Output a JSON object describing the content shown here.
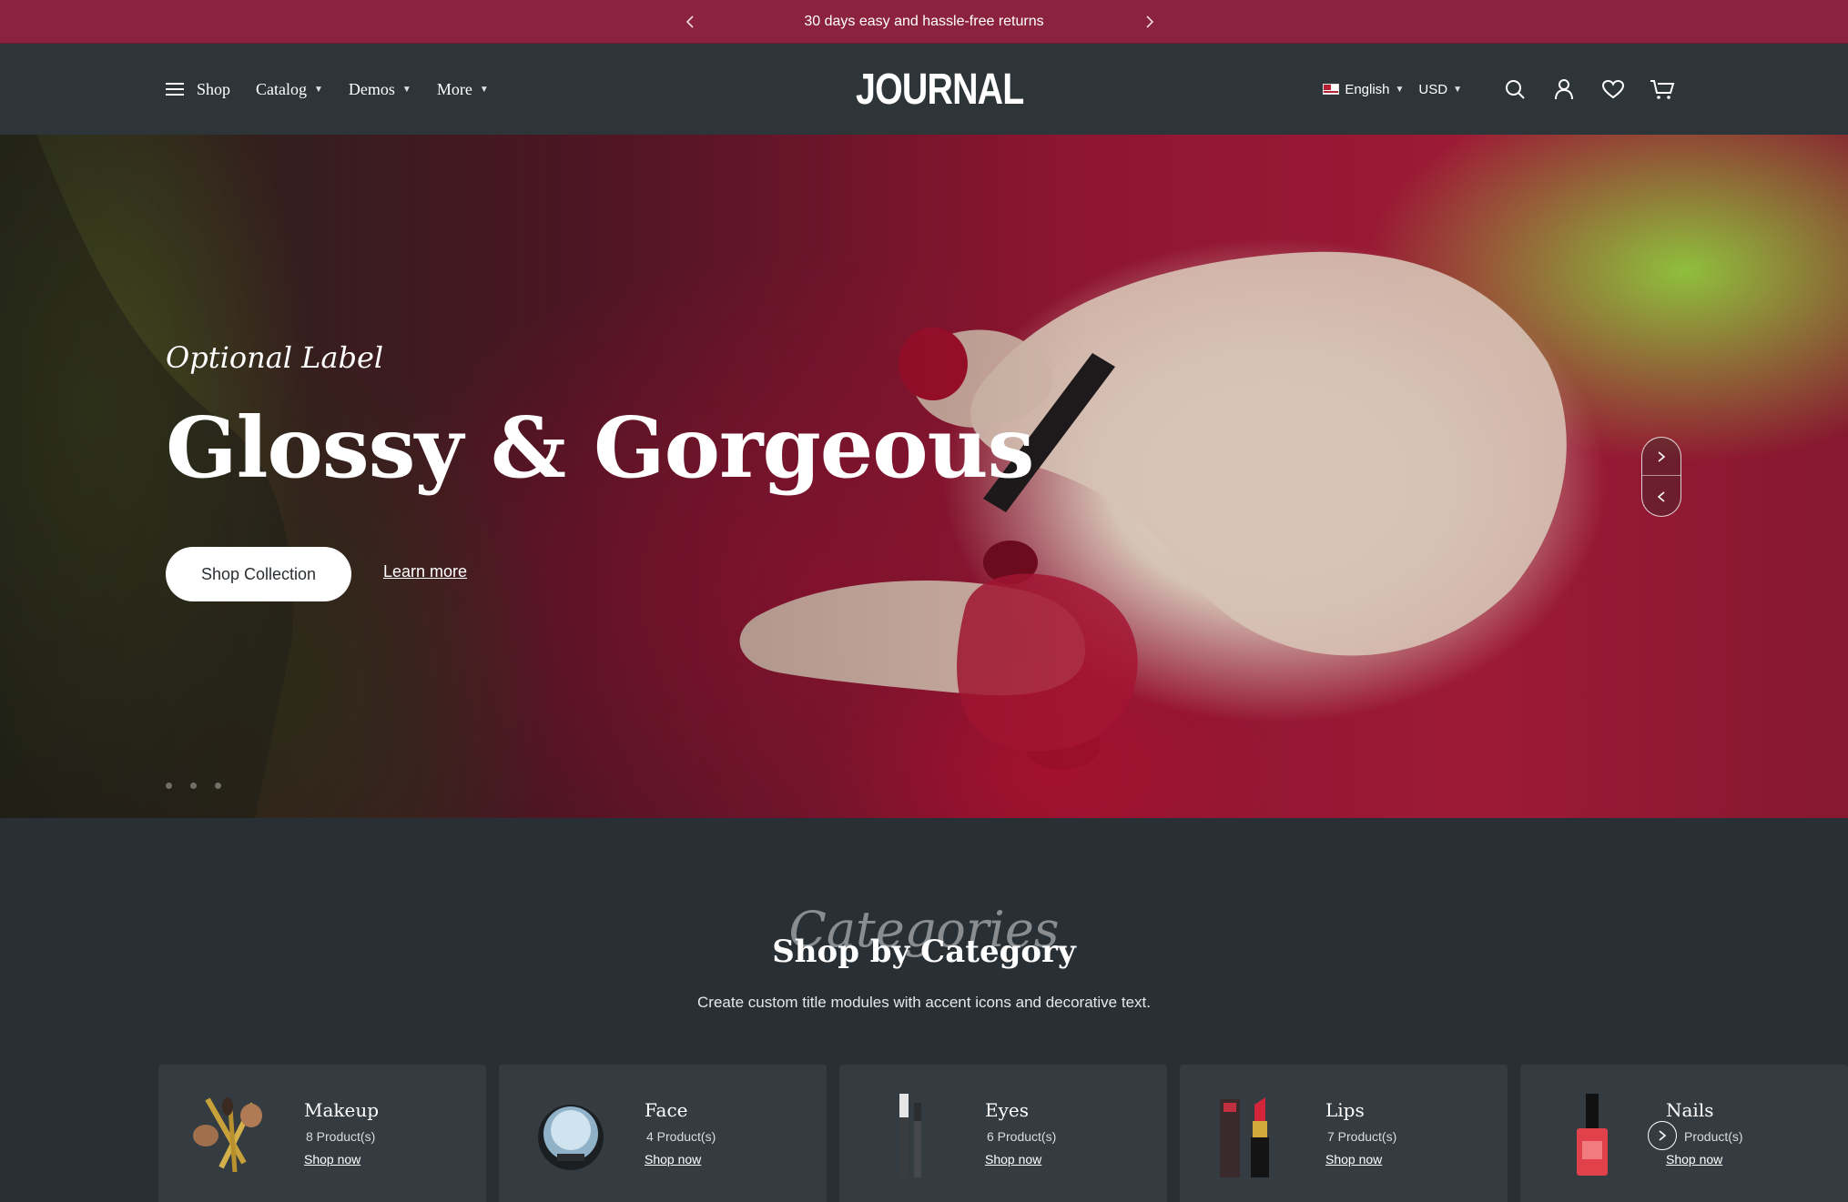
{
  "announcement": {
    "text": "30 days easy and hassle-free returns",
    "prev_icon": "chevron-left-icon",
    "next_icon": "chevron-right-icon"
  },
  "header": {
    "menu_label": "Shop",
    "nav": [
      {
        "label": "Catalog"
      },
      {
        "label": "Demos"
      },
      {
        "label": "More"
      }
    ],
    "logo": "JOURNAL",
    "language": "English",
    "currency": "USD",
    "icons": [
      "search-icon",
      "account-icon",
      "wishlist-icon",
      "cart-icon"
    ]
  },
  "hero": {
    "label": "Optional Label",
    "title": "Glossy & Gorgeous",
    "primary_button": "Shop Collection",
    "secondary_link": "Learn more",
    "slide_count": 3
  },
  "categories": {
    "accent": "Categories",
    "title": "Shop by Category",
    "subtitle": "Create custom title modules with accent icons and decorative text.",
    "items": [
      {
        "name": "Makeup",
        "count": "8  Product(s)",
        "cta": "Shop now"
      },
      {
        "name": "Face",
        "count": "4  Product(s)",
        "cta": "Shop now"
      },
      {
        "name": "Eyes",
        "count": "6  Product(s)",
        "cta": "Shop now"
      },
      {
        "name": "Lips",
        "count": "7  Product(s)",
        "cta": "Shop now"
      },
      {
        "name": "Nails",
        "count": "Product(s)",
        "cta": "Shop now"
      }
    ]
  },
  "colors": {
    "accent": "#8b233f",
    "header_bg": "#2e3539",
    "page_bg": "#293035",
    "card_bg": "#353c41"
  }
}
